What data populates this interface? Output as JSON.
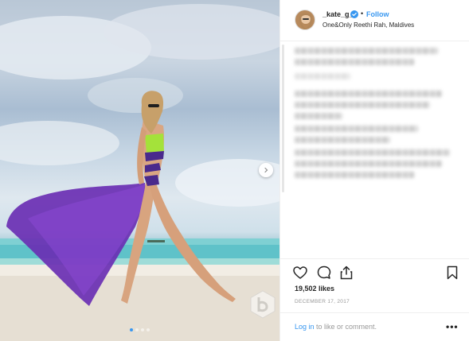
{
  "post": {
    "image_alt": "Woman in purple swimsuit with flowing purple sarong on a beach"
  },
  "carousel": {
    "next_icon": "chevron-right-icon",
    "dot_count": 4,
    "active_index": 0
  },
  "header": {
    "username": "_kate_g_",
    "verified_icon": "verified-badge-icon",
    "separator": "•",
    "follow_label": "Follow",
    "location": "One&Only Reethi Rah, Maldives"
  },
  "actions": {
    "like_icon": "heart-icon",
    "comment_icon": "comment-icon",
    "share_icon": "share-icon",
    "save_icon": "bookmark-icon"
  },
  "stats": {
    "likes": "19,502 likes",
    "date": "DECEMBER 17, 2017"
  },
  "footer": {
    "login_link": "Log in",
    "login_rest": " to like or comment.",
    "more_label": "•••"
  },
  "colors": {
    "accent": "#3897f0",
    "text": "#262626",
    "muted": "#999999",
    "border": "#efefef"
  }
}
